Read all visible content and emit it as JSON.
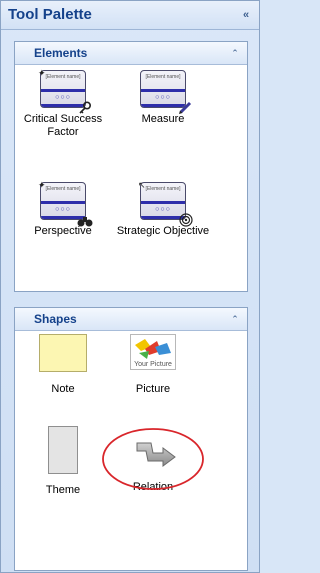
{
  "palette": {
    "title": "Tool Palette",
    "collapse_glyph": "«"
  },
  "groups": {
    "elements": {
      "title": "Elements",
      "collapse_glyph": "⌃",
      "card_text": "[Element name]",
      "card_dots": "○○○",
      "items": [
        {
          "label": "Critical Success Factor",
          "badge_icon": "key-icon"
        },
        {
          "label": "Measure",
          "badge_icon": "pencil-icon"
        },
        {
          "label": "Perspective",
          "badge_icon": "binoculars-icon"
        },
        {
          "label": "Strategic Objective",
          "badge_icon": "target-icon"
        }
      ]
    },
    "shapes": {
      "title": "Shapes",
      "collapse_glyph": "⌃",
      "items": [
        {
          "label": "Note",
          "icon": "note-icon"
        },
        {
          "label": "Picture",
          "icon": "picture-icon",
          "caption": "Your Picture"
        },
        {
          "label": "Theme",
          "icon": "theme-icon"
        },
        {
          "label": "Relation",
          "icon": "relation-arrow-icon"
        }
      ],
      "highlight_color": "#d9262b"
    }
  }
}
